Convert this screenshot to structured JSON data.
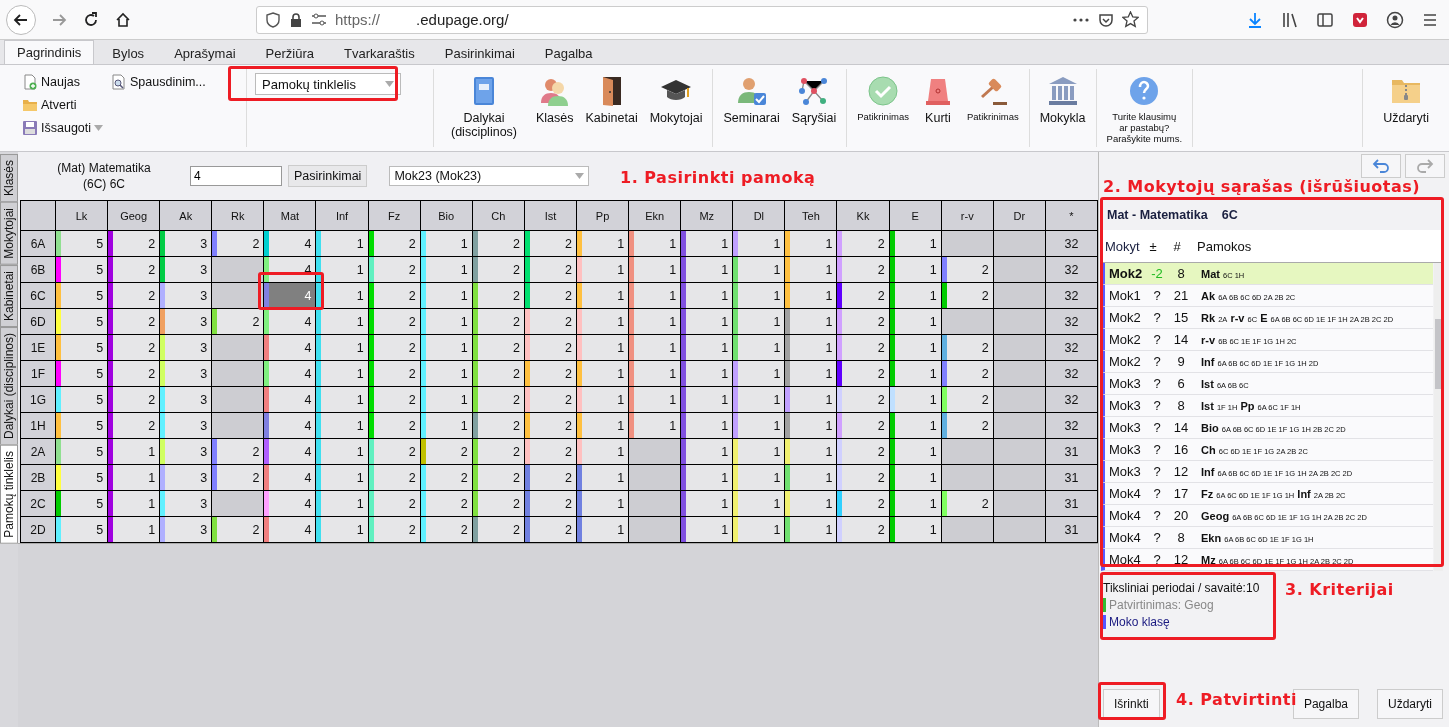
{
  "browser": {
    "url_scheme": "https://",
    "url_domain": ".edupage.org/"
  },
  "menu_tabs": [
    {
      "label": "Pagrindinis",
      "selected": true
    },
    {
      "label": "Bylos",
      "selected": false
    },
    {
      "label": "Aprašymai",
      "selected": false
    },
    {
      "label": "Peržiūra",
      "selected": false
    },
    {
      "label": "Tvarkaraštis",
      "selected": false
    },
    {
      "label": "Pasirinkimai",
      "selected": false
    },
    {
      "label": "Pagalba",
      "selected": false
    }
  ],
  "ribbon": {
    "file_actions": [
      {
        "label": "Naujas",
        "kind": "new"
      },
      {
        "label": "Atverti",
        "kind": "open"
      },
      {
        "label": "Išsaugoti",
        "kind": "save"
      }
    ],
    "print_action": {
      "label": "Spausdinim...",
      "kind": "print"
    },
    "view_select": "Pamokų tinklelis",
    "groups": [
      [
        {
          "label": "Dalykai (disciplinos)",
          "kind": "book",
          "small": false
        },
        {
          "label": "Klasės",
          "kind": "people",
          "small": false
        },
        {
          "label": "Kabinetai",
          "kind": "door",
          "small": false
        },
        {
          "label": "Mokytojai",
          "kind": "cap",
          "small": false
        }
      ],
      [
        {
          "label": "Seminarai",
          "kind": "person",
          "small": false
        },
        {
          "label": "Sąryšiai",
          "kind": "network",
          "small": false
        }
      ],
      [
        {
          "label": "Patikrinimas",
          "kind": "check",
          "small": true
        },
        {
          "label": "Kurti",
          "kind": "siren",
          "small": false
        },
        {
          "label": "Patikrinimas",
          "kind": "gavel",
          "small": true
        }
      ],
      [
        {
          "label": "Mokykla",
          "kind": "bank",
          "small": false
        }
      ]
    ],
    "feedback": {
      "kind": "question",
      "lines": [
        "Turite klausimų",
        "ar pastabų?",
        "Parašykite mums."
      ]
    },
    "close": {
      "label": "Uždaryti",
      "kind": "zip"
    }
  },
  "side_tabs": [
    {
      "label": "Klasės",
      "selected": false
    },
    {
      "label": "Mokytojai",
      "selected": false
    },
    {
      "label": "Kabinetai",
      "selected": false
    },
    {
      "label": "Dalykai (disciplinos)",
      "selected": false
    },
    {
      "label": "Pamokų tinklelis",
      "selected": true
    }
  ],
  "lesson_header": {
    "subject_lines": [
      "(Mat) Matematika",
      "(6C) 6C"
    ],
    "count_input": "4",
    "options_button": "Pasirinkimai",
    "teacher_select": "Mok23 (Mok23)"
  },
  "grid": {
    "columns": [
      "Lk",
      "Geog",
      "Ak",
      "Rk",
      "Mat",
      "Inf",
      "Fz",
      "Bio",
      "Ch",
      "Ist",
      "Pp",
      "Ekn",
      "Mz",
      "Dl",
      "Teh",
      "Kk",
      "E",
      "r-v",
      "Dr",
      "*"
    ],
    "rows": [
      {
        "label": "6A",
        "total": "32",
        "cells": [
          {
            "value": "5",
            "color": "#90e090",
            "selected": false
          },
          {
            "value": "2",
            "color": "#a000e0",
            "selected": false
          },
          {
            "value": "3",
            "color": "#00cc44",
            "selected": false
          },
          {
            "value": "2",
            "color": "#8080ff",
            "selected": false
          },
          {
            "value": "4",
            "color": "#00d0d0",
            "selected": false
          },
          {
            "value": "1",
            "color": "#40e0f0",
            "selected": false
          },
          {
            "value": "2",
            "color": "#00dd00",
            "selected": false
          },
          {
            "value": "1",
            "color": "#60f0ff",
            "selected": false
          },
          {
            "value": "2",
            "color": "#80a0a0",
            "selected": false
          },
          {
            "value": "2",
            "color": "#00e070",
            "selected": false
          },
          {
            "value": "1",
            "color": "#ffc040",
            "selected": false
          },
          {
            "value": "1",
            "color": "#f09080",
            "selected": false
          },
          {
            "value": "1",
            "color": "#8050e0",
            "selected": false
          },
          {
            "value": "1",
            "color": "#c0a0ff",
            "selected": false
          },
          {
            "value": "1",
            "color": "#ffc040",
            "selected": false
          },
          {
            "value": "2",
            "color": "#d0a0ff",
            "selected": false
          },
          {
            "value": "1",
            "color": "#00cc00",
            "selected": false
          },
          {
            "selected": false
          },
          {
            "selected": false
          }
        ]
      },
      {
        "label": "6B",
        "total": "32",
        "cells": [
          {
            "value": "5",
            "color": "#ff00ff",
            "selected": false
          },
          {
            "value": "2",
            "color": "#a000e0",
            "selected": false
          },
          {
            "value": "3",
            "color": "#00cc44",
            "selected": false
          },
          {
            "selected": false
          },
          {
            "value": "4",
            "color": "#80f080",
            "selected": false
          },
          {
            "value": "1",
            "color": "#40e0f0",
            "selected": false
          },
          {
            "value": "2",
            "color": "#60f0c0",
            "selected": false
          },
          {
            "value": "1",
            "color": "#60f0ff",
            "selected": false
          },
          {
            "value": "2",
            "color": "#80a0a0",
            "selected": false
          },
          {
            "value": "2",
            "color": "#00e070",
            "selected": false
          },
          {
            "value": "1",
            "color": "#ffc0c0",
            "selected": false
          },
          {
            "value": "1",
            "color": "#f09080",
            "selected": false
          },
          {
            "value": "1",
            "color": "#8050e0",
            "selected": false
          },
          {
            "value": "1",
            "color": "#70e070",
            "selected": false
          },
          {
            "value": "1",
            "color": "#ffc040",
            "selected": false
          },
          {
            "value": "2",
            "color": "#d0a0ff",
            "selected": false
          },
          {
            "value": "1",
            "color": "#00cc00",
            "selected": false
          },
          {
            "value": "2",
            "color": "#8080ff",
            "selected": false
          },
          {
            "selected": false
          }
        ]
      },
      {
        "label": "6C",
        "total": "32",
        "cells": [
          {
            "value": "5",
            "color": "#ffc040",
            "selected": false
          },
          {
            "value": "2",
            "color": "#a000e0",
            "selected": false
          },
          {
            "value": "3",
            "color": "#b0b0ff",
            "selected": false
          },
          {
            "selected": false
          },
          {
            "value": "4",
            "color": "#8080e0",
            "selected": true
          },
          {
            "value": "1",
            "color": "#40e0f0",
            "selected": false
          },
          {
            "value": "2",
            "color": "#00dd00",
            "selected": false
          },
          {
            "value": "1",
            "color": "#60f0ff",
            "selected": false
          },
          {
            "value": "2",
            "color": "#80e040",
            "selected": false
          },
          {
            "value": "2",
            "color": "#00e070",
            "selected": false
          },
          {
            "value": "1",
            "color": "#ffc040",
            "selected": false
          },
          {
            "value": "1",
            "color": "#f09080",
            "selected": false
          },
          {
            "value": "1",
            "color": "#8050e0",
            "selected": false
          },
          {
            "value": "1",
            "color": "#70e070",
            "selected": false
          },
          {
            "value": "1",
            "color": "#ffc040",
            "selected": false
          },
          {
            "value": "2",
            "color": "#6000ff",
            "selected": false
          },
          {
            "value": "1",
            "color": "#00cc00",
            "selected": false
          },
          {
            "value": "2",
            "color": "#00cc00",
            "selected": false
          },
          {
            "selected": false
          }
        ]
      },
      {
        "label": "6D",
        "total": "32",
        "cells": [
          {
            "value": "5",
            "color": "#ffff40",
            "selected": false
          },
          {
            "value": "2",
            "color": "#a000e0",
            "selected": false
          },
          {
            "value": "3",
            "color": "#f0a060",
            "selected": false
          },
          {
            "value": "2",
            "color": "#80e040",
            "selected": false
          },
          {
            "value": "4",
            "color": "#80f080",
            "selected": false
          },
          {
            "value": "1",
            "color": "#40e0f0",
            "selected": false
          },
          {
            "value": "2",
            "color": "#00dd00",
            "selected": false
          },
          {
            "value": "1",
            "color": "#60f0ff",
            "selected": false
          },
          {
            "value": "2",
            "color": "#80e040",
            "selected": false
          },
          {
            "value": "2",
            "color": "#ffc0c0",
            "selected": false
          },
          {
            "value": "1",
            "color": "#ffc0c0",
            "selected": false
          },
          {
            "value": "1",
            "color": "#f09080",
            "selected": false
          },
          {
            "value": "1",
            "color": "#8050e0",
            "selected": false
          },
          {
            "value": "1",
            "color": "#70e070",
            "selected": false
          },
          {
            "value": "1",
            "color": "#a0a0a0",
            "selected": false
          },
          {
            "value": "2",
            "color": "#d0a0ff",
            "selected": false
          },
          {
            "value": "1",
            "color": "#00cc00",
            "selected": false
          },
          {
            "selected": false
          },
          {
            "selected": false
          }
        ]
      },
      {
        "label": "1E",
        "total": "32",
        "cells": [
          {
            "value": "5",
            "color": "#ffc040",
            "selected": false
          },
          {
            "value": "2",
            "color": "#a000e0",
            "selected": false
          },
          {
            "value": "3",
            "color": "#d0ff60",
            "selected": false
          },
          {
            "selected": false
          },
          {
            "value": "4",
            "color": "#f08080",
            "selected": false
          },
          {
            "value": "1",
            "color": "#40e0f0",
            "selected": false
          },
          {
            "value": "2",
            "color": "#00dd00",
            "selected": false
          },
          {
            "value": "1",
            "color": "#60f0ff",
            "selected": false
          },
          {
            "value": "2",
            "color": "#80e040",
            "selected": false
          },
          {
            "value": "2",
            "color": "#ffc0c0",
            "selected": false
          },
          {
            "value": "1",
            "color": "#ffc0c0",
            "selected": false
          },
          {
            "value": "1",
            "color": "#f09080",
            "selected": false
          },
          {
            "value": "1",
            "color": "#8050e0",
            "selected": false
          },
          {
            "value": "1",
            "color": "#70e070",
            "selected": false
          },
          {
            "value": "1",
            "color": "#a0a0a0",
            "selected": false
          },
          {
            "value": "2",
            "color": "#d0a0ff",
            "selected": false
          },
          {
            "value": "1",
            "color": "#00cc00",
            "selected": false
          },
          {
            "value": "2",
            "color": "#60b0e0",
            "selected": false
          },
          {
            "selected": false
          }
        ]
      },
      {
        "label": "1F",
        "total": "32",
        "cells": [
          {
            "value": "5",
            "color": "#ff00ff",
            "selected": false
          },
          {
            "value": "2",
            "color": "#a000e0",
            "selected": false
          },
          {
            "value": "3",
            "color": "#d0ff60",
            "selected": false
          },
          {
            "selected": false
          },
          {
            "value": "4",
            "color": "#80f080",
            "selected": false
          },
          {
            "value": "1",
            "color": "#40e0f0",
            "selected": false
          },
          {
            "value": "2",
            "color": "#00dd00",
            "selected": false
          },
          {
            "value": "1",
            "color": "#60f0ff",
            "selected": false
          },
          {
            "value": "2",
            "color": "#80e040",
            "selected": false
          },
          {
            "value": "2",
            "color": "#ffc040",
            "selected": false
          },
          {
            "value": "1",
            "color": "#ffc040",
            "selected": false
          },
          {
            "value": "1",
            "color": "#f09080",
            "selected": false
          },
          {
            "value": "1",
            "color": "#8050e0",
            "selected": false
          },
          {
            "value": "1",
            "color": "#c0a0ff",
            "selected": false
          },
          {
            "value": "1",
            "color": "#a0a0a0",
            "selected": false
          },
          {
            "value": "2",
            "color": "#6000ff",
            "selected": false
          },
          {
            "value": "1",
            "color": "#00cc00",
            "selected": false
          },
          {
            "value": "2",
            "color": "#8080ff",
            "selected": false
          },
          {
            "selected": false
          }
        ]
      },
      {
        "label": "1G",
        "total": "32",
        "cells": [
          {
            "value": "5",
            "color": "#60f0ff",
            "selected": false
          },
          {
            "value": "2",
            "color": "#a000e0",
            "selected": false
          },
          {
            "value": "3",
            "color": "#60f0ff",
            "selected": false
          },
          {
            "selected": false
          },
          {
            "value": "4",
            "color": "#f08080",
            "selected": false
          },
          {
            "value": "1",
            "color": "#40e0f0",
            "selected": false
          },
          {
            "value": "2",
            "color": "#00dd00",
            "selected": false
          },
          {
            "value": "1",
            "color": "#60f0ff",
            "selected": false
          },
          {
            "value": "2",
            "color": "#80e040",
            "selected": false
          },
          {
            "value": "2",
            "color": "#ffc0c0",
            "selected": false
          },
          {
            "value": "1",
            "color": "#ffc0c0",
            "selected": false
          },
          {
            "value": "1",
            "color": "#f09080",
            "selected": false
          },
          {
            "value": "1",
            "color": "#8050e0",
            "selected": false
          },
          {
            "value": "1",
            "color": "#c0a0ff",
            "selected": false
          },
          {
            "value": "1",
            "color": "#c0a0ff",
            "selected": false
          },
          {
            "value": "2",
            "color": "#d0d0ff",
            "selected": false
          },
          {
            "value": "1",
            "color": "#c0e0ff",
            "selected": false
          },
          {
            "value": "2",
            "color": "#80ff60",
            "selected": false
          },
          {
            "selected": false
          }
        ]
      },
      {
        "label": "1H",
        "total": "32",
        "cells": [
          {
            "value": "5",
            "color": "#ffc040",
            "selected": false
          },
          {
            "value": "2",
            "color": "#a000e0",
            "selected": false
          },
          {
            "value": "3",
            "color": "#60f0ff",
            "selected": false
          },
          {
            "selected": false
          },
          {
            "value": "4",
            "color": "#8080e0",
            "selected": false
          },
          {
            "value": "1",
            "color": "#40e0f0",
            "selected": false
          },
          {
            "value": "2",
            "color": "#00dd00",
            "selected": false
          },
          {
            "value": "1",
            "color": "#60f0ff",
            "selected": false
          },
          {
            "value": "2",
            "color": "#80a0a0",
            "selected": false
          },
          {
            "value": "2",
            "color": "#ffc040",
            "selected": false
          },
          {
            "value": "1",
            "color": "#ffc040",
            "selected": false
          },
          {
            "value": "1",
            "color": "#f09080",
            "selected": false
          },
          {
            "value": "1",
            "color": "#8050e0",
            "selected": false
          },
          {
            "value": "1",
            "color": "#c0a0ff",
            "selected": false
          },
          {
            "value": "1",
            "color": "#a0a0a0",
            "selected": false
          },
          {
            "value": "2",
            "color": "#d0a0ff",
            "selected": false
          },
          {
            "value": "1",
            "color": "#00cc00",
            "selected": false
          },
          {
            "value": "2",
            "color": "#60b0e0",
            "selected": false
          },
          {
            "selected": false
          }
        ]
      },
      {
        "label": "2A",
        "total": "31",
        "cells": [
          {
            "value": "5",
            "color": "#90e090",
            "selected": false
          },
          {
            "value": "1",
            "color": "#a000e0",
            "selected": false
          },
          {
            "value": "3",
            "color": "#d0ff60",
            "selected": false
          },
          {
            "value": "2",
            "color": "#8080ff",
            "selected": false
          },
          {
            "value": "4",
            "color": "#b060ff",
            "selected": false
          },
          {
            "value": "1",
            "color": "#40e0f0",
            "selected": false
          },
          {
            "value": "2",
            "color": "#60f0c0",
            "selected": false
          },
          {
            "value": "2",
            "color": "#c0c000",
            "selected": false
          },
          {
            "value": "2",
            "color": "#80e040",
            "selected": false
          },
          {
            "value": "2",
            "color": "#ffc0c0",
            "selected": false
          },
          {
            "value": "1",
            "color": "#ffc0c0",
            "selected": false
          },
          {
            "selected": false
          },
          {
            "value": "1",
            "color": "#8050e0",
            "selected": false
          },
          {
            "value": "1",
            "color": "#f0f070",
            "selected": false
          },
          {
            "value": "1",
            "color": "#f0f070",
            "selected": false
          },
          {
            "value": "2",
            "color": "#d0d0ff",
            "selected": false
          },
          {
            "value": "1",
            "color": "#00cc00",
            "selected": false
          },
          {
            "selected": false
          },
          {
            "selected": false
          }
        ]
      },
      {
        "label": "2B",
        "total": "31",
        "cells": [
          {
            "value": "5",
            "color": "#ffff40",
            "selected": false
          },
          {
            "value": "1",
            "color": "#a000e0",
            "selected": false
          },
          {
            "value": "3",
            "color": "#b0b0ff",
            "selected": false
          },
          {
            "value": "2",
            "color": "#8080ff",
            "selected": false
          },
          {
            "value": "4",
            "color": "#f08080",
            "selected": false
          },
          {
            "value": "1",
            "color": "#40e0f0",
            "selected": false
          },
          {
            "value": "2",
            "color": "#60f0c0",
            "selected": false
          },
          {
            "value": "2",
            "color": "#60f0ff",
            "selected": false
          },
          {
            "value": "2",
            "color": "#80e040",
            "selected": false
          },
          {
            "value": "2",
            "color": "#7080e0",
            "selected": false
          },
          {
            "value": "1",
            "color": "#7080e0",
            "selected": false
          },
          {
            "selected": false
          },
          {
            "value": "1",
            "color": "#8050e0",
            "selected": false
          },
          {
            "value": "1",
            "color": "#f0f070",
            "selected": false
          },
          {
            "value": "1",
            "color": "#70e070",
            "selected": false
          },
          {
            "value": "2",
            "color": "#d0d0ff",
            "selected": false
          },
          {
            "value": "1",
            "color": "#00cc00",
            "selected": false
          },
          {
            "selected": false
          },
          {
            "selected": false
          }
        ]
      },
      {
        "label": "2C",
        "total": "31",
        "cells": [
          {
            "value": "5",
            "color": "#00cc00",
            "selected": false
          },
          {
            "value": "1",
            "color": "#a000e0",
            "selected": false
          },
          {
            "value": "3",
            "color": "#60f0ff",
            "selected": false
          },
          {
            "selected": false
          },
          {
            "value": "4",
            "color": "#ffa0ff",
            "selected": false
          },
          {
            "value": "1",
            "color": "#40e0f0",
            "selected": false
          },
          {
            "value": "2",
            "color": "#60f0c0",
            "selected": false
          },
          {
            "value": "2",
            "color": "#60f0ff",
            "selected": false
          },
          {
            "value": "2",
            "color": "#80e040",
            "selected": false
          },
          {
            "value": "2",
            "color": "#7080e0",
            "selected": false
          },
          {
            "value": "1",
            "color": "#7080e0",
            "selected": false
          },
          {
            "selected": false
          },
          {
            "value": "1",
            "color": "#8050e0",
            "selected": false
          },
          {
            "value": "1",
            "color": "#f0f070",
            "selected": false
          },
          {
            "value": "1",
            "color": "#f0f070",
            "selected": false
          },
          {
            "value": "2",
            "color": "#30d0ff",
            "selected": false
          },
          {
            "value": "1",
            "color": "#00cc00",
            "selected": false
          },
          {
            "value": "2",
            "color": "#80ff60",
            "selected": false
          },
          {
            "selected": false
          }
        ]
      },
      {
        "label": "2D",
        "total": "31",
        "cells": [
          {
            "value": "5",
            "color": "#60f0ff",
            "selected": false
          },
          {
            "value": "1",
            "color": "#a000e0",
            "selected": false
          },
          {
            "value": "3",
            "color": "#b0b0ff",
            "selected": false
          },
          {
            "value": "2",
            "color": "#80e040",
            "selected": false
          },
          {
            "value": "4",
            "color": "#f08080",
            "selected": false
          },
          {
            "value": "1",
            "color": "#40e0f0",
            "selected": false
          },
          {
            "value": "2",
            "color": "#60f0c0",
            "selected": false
          },
          {
            "value": "2",
            "color": "#60f0ff",
            "selected": false
          },
          {
            "value": "2",
            "color": "#80a0a0",
            "selected": false
          },
          {
            "value": "2",
            "color": "#7080e0",
            "selected": false
          },
          {
            "value": "1",
            "color": "#7080e0",
            "selected": false
          },
          {
            "selected": false
          },
          {
            "value": "1",
            "color": "#8050e0",
            "selected": false
          },
          {
            "value": "1",
            "color": "#f0f070",
            "selected": false
          },
          {
            "value": "1",
            "color": "#70e070",
            "selected": false
          },
          {
            "value": "2",
            "color": "#d0d0ff",
            "selected": false
          },
          {
            "value": "1",
            "color": "#00cc00",
            "selected": false
          },
          {
            "selected": false
          },
          {
            "selected": false
          }
        ]
      }
    ]
  },
  "teacher_panel": {
    "subject": "Mat - Matematika",
    "class": "6C",
    "headers": [
      "Mokyt",
      "±",
      "#",
      "Pamokos"
    ],
    "teachers": [
      {
        "name": "Mok2",
        "diff": "-2",
        "count": "8",
        "selected": true,
        "lessons": [
          {
            "subject": "Mat",
            "classes": "6C 1H"
          }
        ]
      },
      {
        "name": "Mok1",
        "diff": "?",
        "count": "21",
        "selected": false,
        "lessons": [
          {
            "subject": "Ak",
            "classes": "6A 6B 6C 6D 2A 2B 2C"
          }
        ]
      },
      {
        "name": "Mok2",
        "diff": "?",
        "count": "15",
        "selected": false,
        "lessons": [
          {
            "subject": "Rk",
            "classes": "2A"
          },
          {
            "subject": "r-v",
            "classes": "6C"
          },
          {
            "subject": "E",
            "classes": "6A 6B 6C 6D 1E 1F 1H 2A 2B 2C 2D"
          }
        ]
      },
      {
        "name": "Mok2",
        "diff": "?",
        "count": "14",
        "selected": false,
        "lessons": [
          {
            "subject": "r-v",
            "classes": "6B 6C 1E 1F 1G 1H 2C"
          }
        ]
      },
      {
        "name": "Mok2",
        "diff": "?",
        "count": "9",
        "selected": false,
        "lessons": [
          {
            "subject": "Inf",
            "classes": "6A 6B 6C 6D 1E 1F 1G 1H 2D"
          }
        ]
      },
      {
        "name": "Mok3",
        "diff": "?",
        "count": "6",
        "selected": false,
        "lessons": [
          {
            "subject": "Ist",
            "classes": "6A 6B 6C"
          }
        ]
      },
      {
        "name": "Mok3",
        "diff": "?",
        "count": "8",
        "selected": false,
        "lessons": [
          {
            "subject": "Ist",
            "classes": "1F 1H"
          },
          {
            "subject": "Pp",
            "classes": "6A 6C 1F 1H"
          }
        ]
      },
      {
        "name": "Mok3",
        "diff": "?",
        "count": "14",
        "selected": false,
        "lessons": [
          {
            "subject": "Bio",
            "classes": "6A 6B 6C 6D 1E 1F 1G 1H 2B 2C 2D"
          }
        ]
      },
      {
        "name": "Mok3",
        "diff": "?",
        "count": "16",
        "selected": false,
        "lessons": [
          {
            "subject": "Ch",
            "classes": "6C 6D 1E 1F 1G 2A 2B 2C"
          }
        ]
      },
      {
        "name": "Mok3",
        "diff": "?",
        "count": "12",
        "selected": false,
        "lessons": [
          {
            "subject": "Inf",
            "classes": "6A 6B 6C 6D 1E 1F 1G 1H 2A 2B 2C 2D"
          }
        ]
      },
      {
        "name": "Mok4",
        "diff": "?",
        "count": "17",
        "selected": false,
        "lessons": [
          {
            "subject": "Fz",
            "classes": "6A 6C 6D 1E 1F 1G 1H"
          },
          {
            "subject": "Inf",
            "classes": "2A 2B 2C"
          }
        ]
      },
      {
        "name": "Mok4",
        "diff": "?",
        "count": "20",
        "selected": false,
        "lessons": [
          {
            "subject": "Geog",
            "classes": "6A 6B 6C 6D 1E 1F 1G 1H 2A 2B 2C 2D"
          }
        ]
      },
      {
        "name": "Mok4",
        "diff": "?",
        "count": "8",
        "selected": false,
        "lessons": [
          {
            "subject": "Ekn",
            "classes": "6A 6B 6C 6D 1E 1F 1G 1H"
          }
        ]
      },
      {
        "name": "Mok4",
        "diff": "?",
        "count": "12",
        "selected": false,
        "lessons": [
          {
            "subject": "Mz",
            "classes": "6A 6B 6C 6D 1E 1F 1G 1H 2A 2B 2C 2D"
          }
        ]
      }
    ]
  },
  "criteria": {
    "heading": "Tiksliniai periodai / savaitė:10",
    "items": [
      {
        "text": "Patvirtinimas: Geog",
        "color": "#33bb33"
      },
      {
        "text": "Moko klasę",
        "color": "#5555ff"
      }
    ]
  },
  "dialog_buttons": [
    "Išrinkti",
    "Pagalba",
    "Uždaryti"
  ],
  "annotations": [
    "1. Pasirinkti pamoką",
    "2. Mokytojų sąrašas (išrūšiuotas)",
    "3. Kriterijai",
    "4. Patvirtinti"
  ]
}
